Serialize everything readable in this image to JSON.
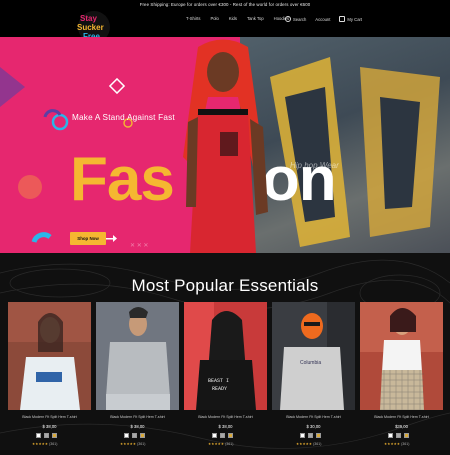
{
  "announcement": "Free Shipping: Europe for orders over €300 - Rest of the world for orders over €600",
  "brand": {
    "logo_text_1": "Stay",
    "logo_text_2": "Sucker",
    "logo_text_3": "Free"
  },
  "nav": {
    "items": [
      "T-Shirts",
      "Polo",
      "Kids",
      "Tank Top",
      "Hoodies"
    ]
  },
  "header_icons": {
    "search": "Search",
    "account": "Account",
    "cart": "My Cart"
  },
  "hero": {
    "tagline": "Make A Stand Against Fast",
    "big_1": "Fas",
    "big_2": "on",
    "overlay": "Hip hop Wear",
    "button": "Shop Now"
  },
  "section": {
    "title": "Most Popular Essentials"
  },
  "products": [
    {
      "name": "Black Modern Fit Split Hem T-shirt",
      "price": "$ 38,00",
      "rating": "★★★★★",
      "reviews": "(361)",
      "swatches": [
        "#ffffff",
        "#a8a8a8",
        "#d8a93a"
      ]
    },
    {
      "name": "Black Modern Fit Split Hem T-shirt",
      "price": "$ 38,00",
      "rating": "★★★★★",
      "reviews": "(361)",
      "swatches": [
        "#ffffff",
        "#a8a8a8",
        "#d8a93a"
      ]
    },
    {
      "name": "Black Modern Fit Split Hem T-shirt",
      "price": "$ 38,00",
      "rating": "★★★★★",
      "reviews": "(361)",
      "swatches": [
        "#ffffff",
        "#a8a8a8",
        "#d8a93a"
      ]
    },
    {
      "name": "Black Modern Fit Split Hem T-shirt",
      "price": "$ 30,00",
      "rating": "★★★★★",
      "reviews": "(361)",
      "swatches": [
        "#ffffff",
        "#a8a8a8",
        "#d8a93a"
      ]
    },
    {
      "name": "Black Modern Fit Split Hem T-shirt",
      "price": "$39,00",
      "rating": "★★★★★",
      "reviews": "(361)",
      "swatches": [
        "#ffffff",
        "#a8a8a8",
        "#d8a93a"
      ]
    }
  ],
  "colors": {
    "accent": "#f5b731",
    "hero_pink": "#e6276f",
    "bg": "#0d0d0d"
  }
}
